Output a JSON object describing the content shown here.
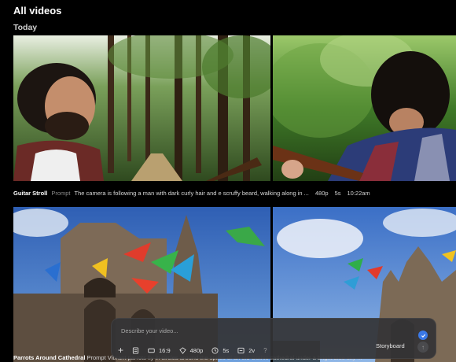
{
  "header": {
    "title": "All videos",
    "section": "Today"
  },
  "videos": [
    {
      "title": "Guitar Stroll",
      "kind": "Prompt",
      "prompt": "The camera is following a man with dark curly hair and e scruffy beard, walking along in ...",
      "resolution": "480p",
      "duration": "5s",
      "time": "10:22am"
    },
    {
      "title": "Parrots Around Cathedral",
      "kind": "Prompt",
      "prompt": "Vibrant parrots fly in circles around the spires of an old Gothic cathedral under a bright blue sky ..."
    }
  ],
  "composer": {
    "placeholder": "Describe your video...",
    "aspect": "16:9",
    "resolution": "480p",
    "duration": "5s",
    "variations": "2v",
    "help": "?",
    "storyboard": "Storyboard",
    "plus": "+",
    "send": "↑"
  },
  "icons": [
    "plus-icon",
    "preset-icon",
    "aspect-ratio-icon",
    "resolution-icon",
    "clock-icon",
    "variations-icon",
    "help-icon",
    "check-icon",
    "arrow-up-icon"
  ],
  "colors": {
    "background": "#000000",
    "composer": "#343436",
    "accent": "#3b79e6"
  }
}
